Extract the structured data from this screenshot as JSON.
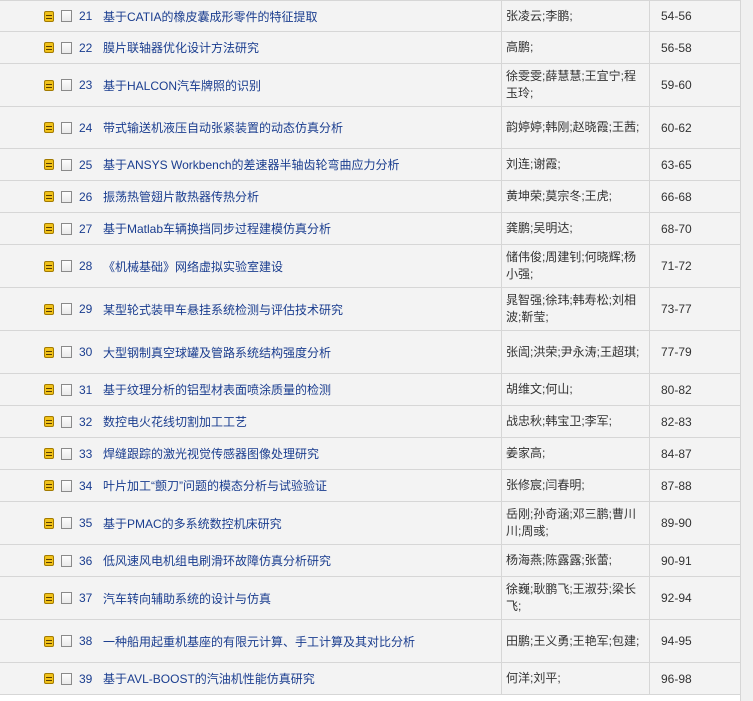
{
  "rows": [
    {
      "num": "21",
      "title": "基于CATIA的橡皮囊成形零件的特征提取",
      "authors": "张凌云;李鹏;",
      "pages": "54-56"
    },
    {
      "num": "22",
      "title": "膜片联轴器优化设计方法研究",
      "authors": "高鹏;",
      "pages": "56-58"
    },
    {
      "num": "23",
      "title": "基于HALCON汽车牌照的识别",
      "authors": "徐雯雯;薛慧慧;王宜宁;程玉玲;",
      "pages": "59-60"
    },
    {
      "num": "24",
      "title": "带式输送机液压自动张紧装置的动态仿真分析",
      "authors": "韵婷婷;韩刚;赵晓霞;王茜;",
      "pages": "60-62"
    },
    {
      "num": "25",
      "title": "基于ANSYS Workbench的差速器半轴齿轮弯曲应力分析",
      "authors": "刘连;谢霞;",
      "pages": "63-65"
    },
    {
      "num": "26",
      "title": "振荡热管翅片散热器传热分析",
      "authors": "黄坤荣;莫宗冬;王虎;",
      "pages": "66-68"
    },
    {
      "num": "27",
      "title": "基于Matlab车辆换挡同步过程建模仿真分析",
      "authors": "龚鹏;吴明达;",
      "pages": "68-70"
    },
    {
      "num": "28",
      "title": "《机械基础》网络虚拟实验室建设",
      "authors": "储伟俊;周建钊;何晓辉;杨小强;",
      "pages": "71-72"
    },
    {
      "num": "29",
      "title": "某型轮式装甲车悬挂系统检测与评估技术研究",
      "authors": "晁智强;徐玮;韩寿松;刘相波;靳莹;",
      "pages": "73-77"
    },
    {
      "num": "30",
      "title": "大型钢制真空球罐及管路系统结构强度分析",
      "authors": "张訚;洪荣;尹永涛;王超琪;",
      "pages": "77-79"
    },
    {
      "num": "31",
      "title": "基于纹理分析的铝型材表面喷涂质量的检测",
      "authors": "胡维文;何山;",
      "pages": "80-82"
    },
    {
      "num": "32",
      "title": "数控电火花线切割加工工艺",
      "authors": "战忠秋;韩宝卫;李军;",
      "pages": "82-83"
    },
    {
      "num": "33",
      "title": "焊缝跟踪的激光视觉传感器图像处理研究",
      "authors": "姜家高;",
      "pages": "84-87"
    },
    {
      "num": "34",
      "title": "叶片加工“颤刀”问题的模态分析与试验验证",
      "authors": "张修宸;闫春明;",
      "pages": "87-88"
    },
    {
      "num": "35",
      "title": "基于PMAC的多系统数控机床研究",
      "authors": "岳刚;孙奇涵;邓三鹏;曹川川;周彧;",
      "pages": "89-90"
    },
    {
      "num": "36",
      "title": "低风速风电机组电刷滑环故障仿真分析研究",
      "authors": "杨海燕;陈露露;张蕾;",
      "pages": "90-91"
    },
    {
      "num": "37",
      "title": "汽车转向辅助系统的设计与仿真",
      "authors": "徐巍;耿鹏飞;王淑芬;梁长飞;",
      "pages": "92-94"
    },
    {
      "num": "38",
      "title": "一种船用起重机基座的有限元计算、手工计算及其对比分析",
      "authors": "田鹏;王义勇;王艳军;包建;",
      "pages": "94-95"
    },
    {
      "num": "39",
      "title": "基于AVL-BOOST的汽油机性能仿真研究",
      "authors": "何洋;刘平;",
      "pages": "96-98"
    }
  ]
}
